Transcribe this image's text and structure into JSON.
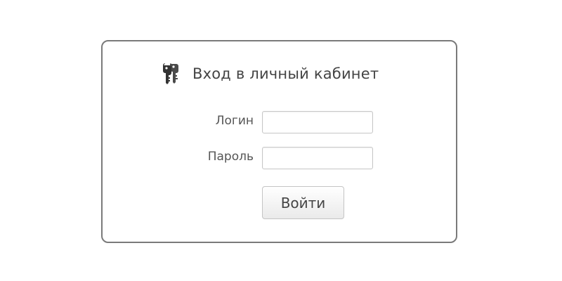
{
  "login_panel": {
    "title": "Вход в личный кабинет",
    "title_icon": "keys-icon",
    "login_label": "Логин",
    "login_value": "",
    "login_placeholder": "",
    "password_label": "Пароль",
    "password_value": "",
    "password_placeholder": "",
    "submit_label": "Войти"
  },
  "colors": {
    "panel_border": "#7a7a7a",
    "text": "#444444",
    "input_border": "#c6c6c6"
  }
}
